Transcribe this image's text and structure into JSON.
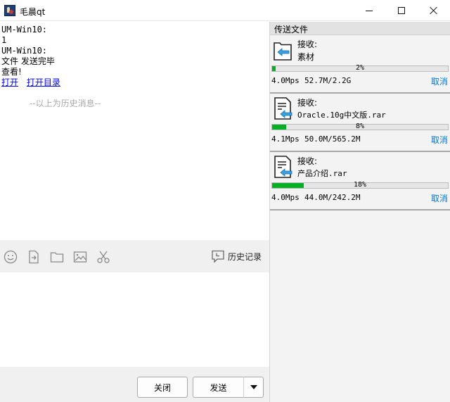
{
  "window": {
    "title": "毛晨qt"
  },
  "chat": {
    "messages": [
      {
        "sender": "UM-Win10:",
        "text": "1"
      },
      {
        "sender": "UM-Win10:",
        "text": "文件 发送完毕"
      }
    ],
    "view_label": "查看!",
    "open_link": "打开",
    "open_dir_link": "打开目录",
    "history_note": "--以上为历史消息--"
  },
  "toolbar": {
    "icons": [
      "emoji-icon",
      "send-file-icon",
      "folder-icon",
      "image-icon",
      "scissors-icon"
    ],
    "history_label": "历史记录"
  },
  "input": {
    "value": "",
    "placeholder": ""
  },
  "buttons": {
    "close": "关闭",
    "send": "发送"
  },
  "transfer": {
    "header": "传送文件",
    "items": [
      {
        "status": "接收:",
        "name": "素材",
        "percent": 2,
        "percent_label": "2%",
        "speed": "4.0Mps",
        "size": "52.7M/2.2G",
        "cancel": "取消",
        "icon": "folder-file-icon"
      },
      {
        "status": "接收:",
        "name": "Oracle.10g中文版.rar",
        "percent": 8,
        "percent_label": "8%",
        "speed": "4.1Mps",
        "size": "50.0M/565.2M",
        "cancel": "取消",
        "icon": "archive-file-icon"
      },
      {
        "status": "接收:",
        "name": "产品介绍.rar",
        "percent": 18,
        "percent_label": "18%",
        "speed": "4.0Mps",
        "size": "44.0M/242.2M",
        "cancel": "取消",
        "icon": "archive-file-icon"
      }
    ]
  },
  "colors": {
    "progress": "#06b025",
    "link": "#0000ee",
    "cancel": "#0078d7",
    "arrow": "#3aa0e0"
  }
}
